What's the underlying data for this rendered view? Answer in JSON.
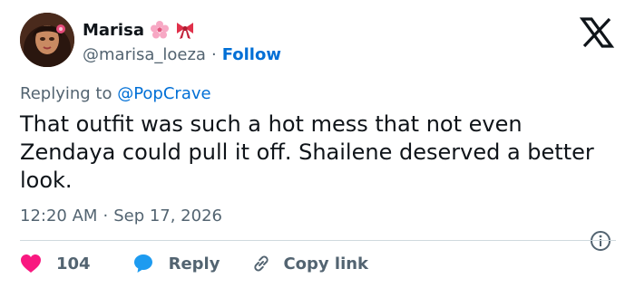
{
  "author": {
    "display_name": "Marisa",
    "handle": "@marisa_loeza",
    "follow_label": "Follow",
    "badges": [
      "cherry-blossom-emoji",
      "ribbon-emoji"
    ]
  },
  "reply_to": {
    "prefix": "Replying to ",
    "mention": "@PopCrave"
  },
  "tweet": {
    "text": "That outfit was such a hot mess that not even Zendaya could pull it off. Shailene deserved a better look.",
    "time": "12:20 AM",
    "date": "Sep 17, 2026"
  },
  "actions": {
    "like_count": "104",
    "reply_label": "Reply",
    "copy_link_label": "Copy link"
  },
  "colors": {
    "link_blue": "#006fd6",
    "secondary_text": "#536471",
    "like_red": "#f91880",
    "reply_blue": "#1d9bf0",
    "divider": "#cfd9de"
  },
  "icons": [
    "x-logo-icon",
    "info-icon",
    "heart-icon",
    "speech-bubble-icon",
    "link-icon"
  ]
}
